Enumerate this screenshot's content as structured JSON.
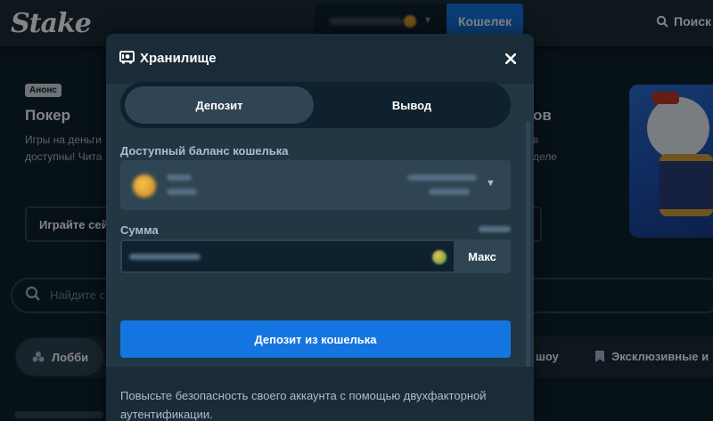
{
  "topbar": {
    "logo": "Stake",
    "wallet_button": "Кошелек",
    "search_label": "Поиск"
  },
  "background": {
    "badge": "Анонс",
    "card_title": "Покер",
    "card_desc_1": "Игры на деньги",
    "card_desc_2": "доступны! Чита",
    "play_button": "Играйте сей",
    "right_title": "ов",
    "right_desc_1": "в",
    "right_desc_2": "деле",
    "search_placeholder": "Найдите с",
    "tab_lobby": "Лобби",
    "tab_show": "шоу",
    "tab_exclusive": "Эксклюзивные и"
  },
  "modal": {
    "title": "Хранилище",
    "tabs": [
      {
        "label": "Депозит",
        "active": true
      },
      {
        "label": "Вывод",
        "active": false
      }
    ],
    "balance_label": "Доступный баланс кошелька",
    "amount_label": "Сумма",
    "max_button": "Макс",
    "deposit_button": "Депозит из кошелька",
    "footer_text": "Повысьте безопасность своего аккаунта с помощью двухфакторной аутентификации."
  },
  "colors": {
    "page_bg": "#0f212e",
    "panel": "#1a2c38",
    "panel_inner": "#213743",
    "control": "#2f4553",
    "accent_blue": "#1475e1",
    "muted_text": "#b1bad3"
  }
}
